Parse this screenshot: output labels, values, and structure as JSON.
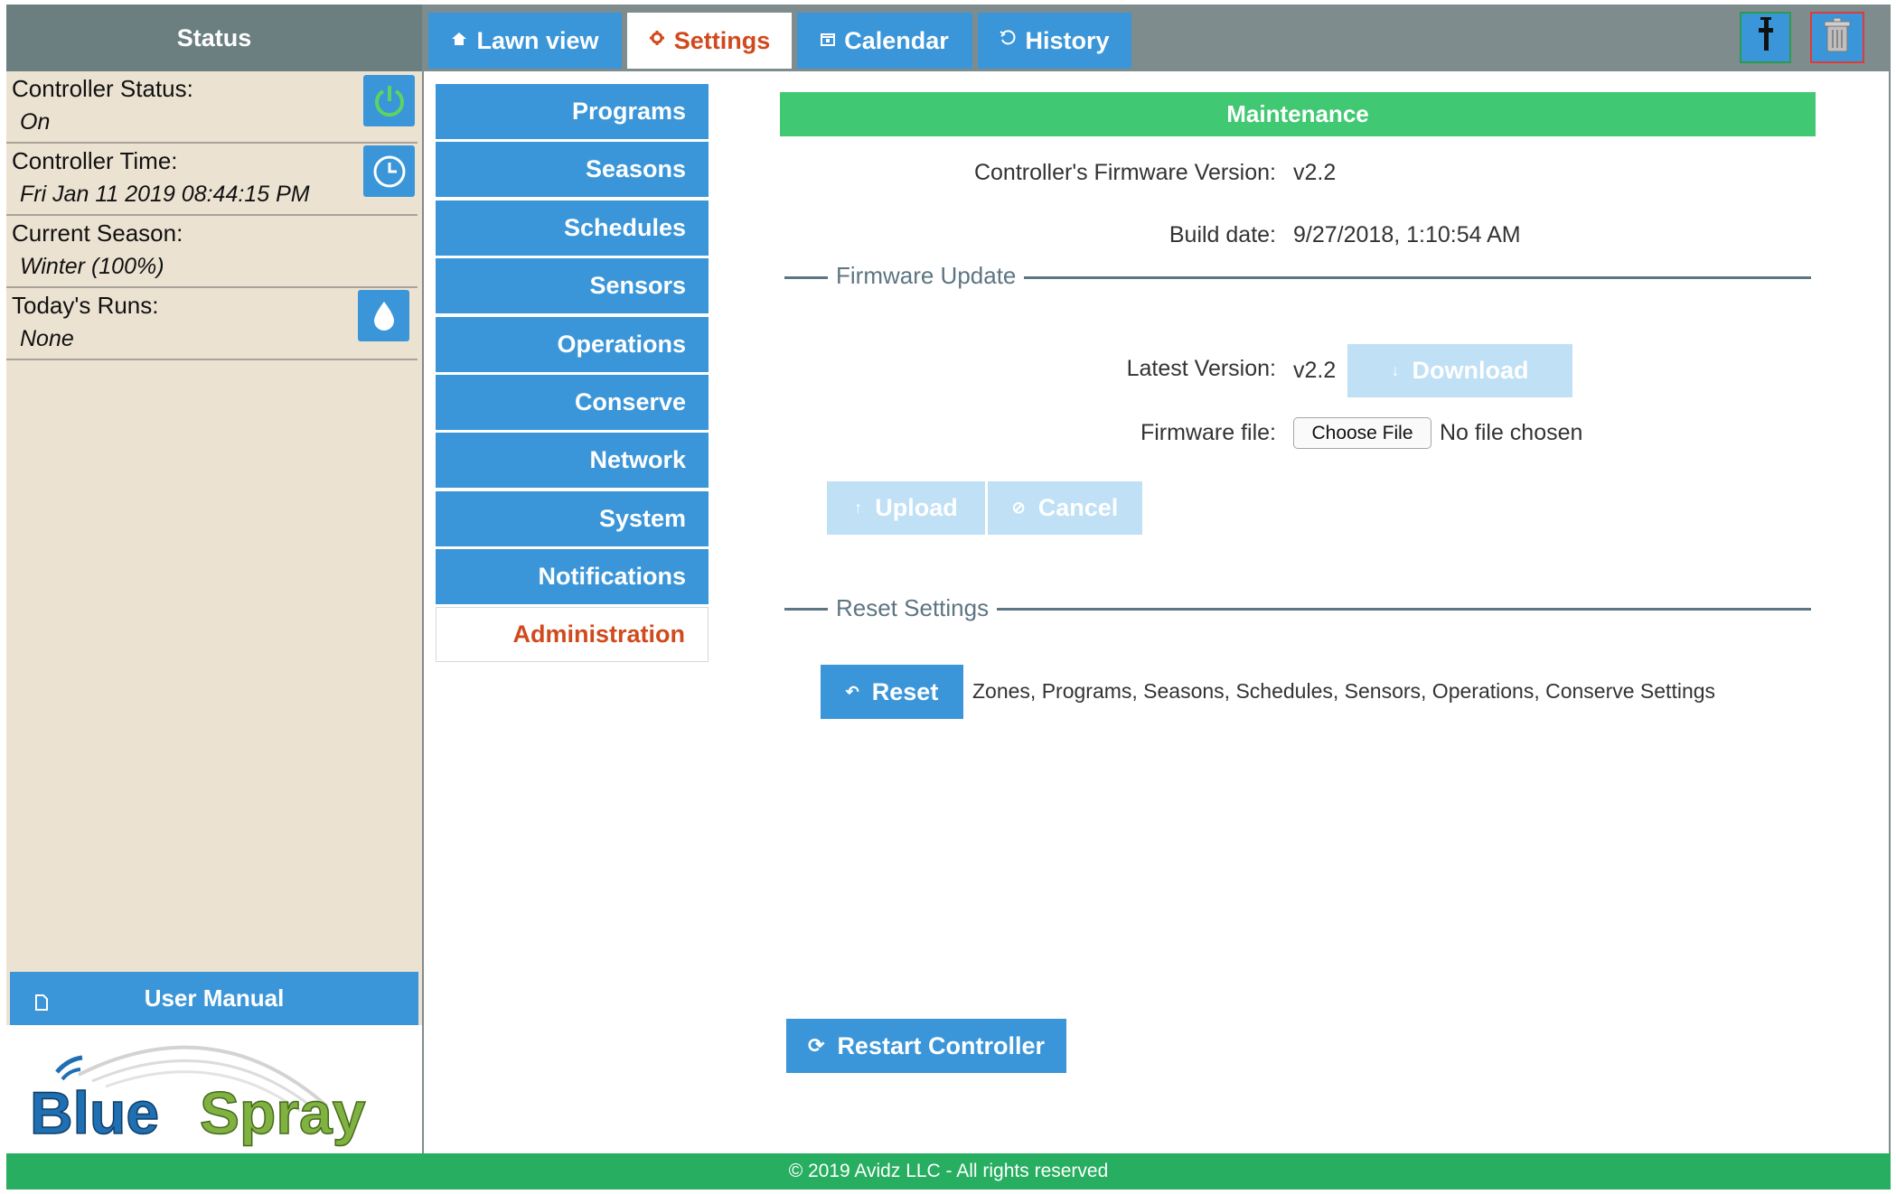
{
  "status": {
    "title": "Status",
    "controller_status_label": "Controller Status:",
    "controller_status_value": "On",
    "controller_time_label": "Controller Time:",
    "controller_time_value": "Fri Jan 11 2019 08:44:15 PM",
    "current_season_label": "Current Season:",
    "current_season_value": "Winter (100%)",
    "todays_runs_label": "Today's Runs:",
    "todays_runs_value": "None",
    "user_manual_label": "User Manual"
  },
  "logo": {
    "part1": "Blue",
    "part2": "Spray"
  },
  "tabs": [
    {
      "label": "Lawn view",
      "icon": "home-icon"
    },
    {
      "label": "Settings",
      "icon": "gear-icon"
    },
    {
      "label": "Calendar",
      "icon": "calendar-icon"
    },
    {
      "label": "History",
      "icon": "history-icon"
    }
  ],
  "menu": [
    "Programs",
    "Seasons",
    "Schedules",
    "Sensors",
    "Operations",
    "Conserve",
    "Network",
    "System",
    "Notifications",
    "Administration"
  ],
  "maintenance": {
    "title": "Maintenance",
    "fw_version_label": "Controller's Firmware Version:",
    "fw_version_value": "v2.2",
    "build_date_label": "Build date:",
    "build_date_value": "9/27/2018, 1:10:54 AM",
    "fw_update_title": "Firmware Update",
    "latest_version_label": "Latest Version:",
    "latest_version_value": "v2.2",
    "download_label": "Download",
    "firmware_file_label": "Firmware file:",
    "choose_file_label": "Choose File",
    "no_file_label": "No file chosen",
    "upload_label": "Upload",
    "cancel_label": "Cancel",
    "reset_settings_title": "Reset Settings",
    "reset_label": "Reset",
    "reset_desc": "Zones, Programs, Seasons, Schedules, Sensors, Operations, Conserve Settings",
    "restart_label": "Restart Controller"
  },
  "footer": {
    "text": "© 2019 Avidz LLC - All rights reserved"
  },
  "colors": {
    "accent_blue": "#3a96d8",
    "active_orange": "#d04a1d",
    "green": "#41c872",
    "footer_green": "#27ae60",
    "status_bg": "#ece2d2"
  }
}
